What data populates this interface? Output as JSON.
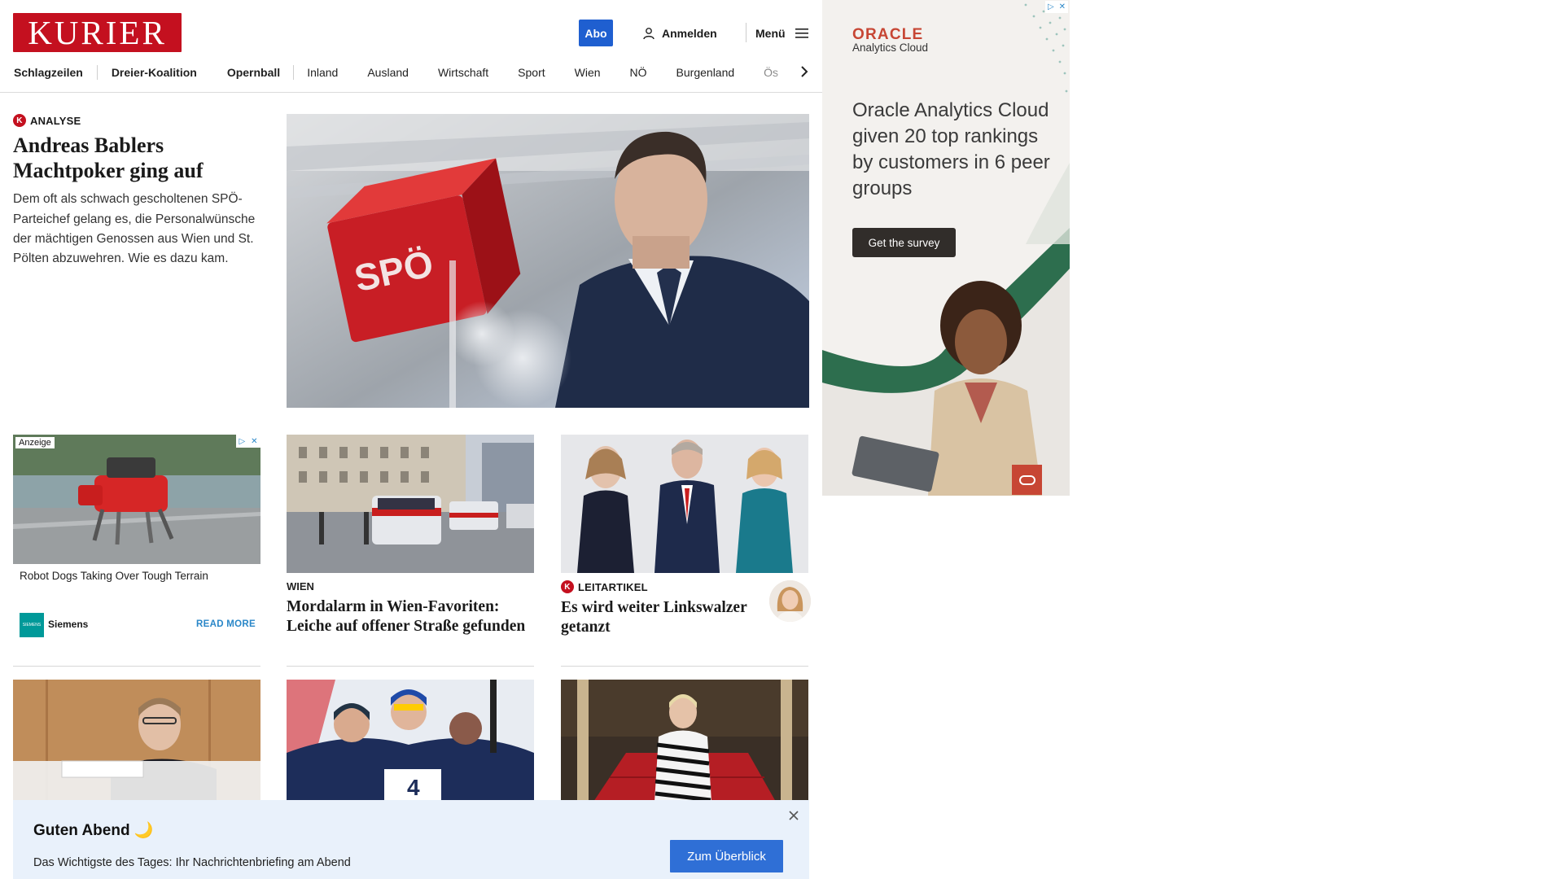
{
  "header": {
    "logo": "KURIER",
    "abo_label": "Abo",
    "login_label": "Anmelden",
    "menu_label": "Menü"
  },
  "nav": {
    "items": [
      "Schlagzeilen",
      "Dreier-Koalition",
      "Opernball",
      "Inland",
      "Ausland",
      "Wirtschaft",
      "Sport",
      "Wien",
      "NÖ",
      "Burgenland",
      "Ös"
    ]
  },
  "lead": {
    "kicker": "ANALYSE",
    "title": "Andreas Bablers Machtpoker ging auf",
    "teaser": "Dem oft als schwach gescholtenen SPÖ-Parteichef gelang es, die Personalwünsche der mächtigen Genossen aus Wien und St. Pölten abzuwehren. Wie es dazu kam.",
    "image_text": "SPÖ"
  },
  "native_ad": {
    "label": "Anzeige",
    "title": "Robot Dogs Taking Over Tough Terrain",
    "advertiser": "Siemens",
    "logo_text": "SIEMENS",
    "cta": "READ MORE"
  },
  "cards": [
    {
      "kicker": "WIEN",
      "title": "Mordalarm in Wien-Favoriten: Leiche auf offener Straße gefunden"
    },
    {
      "kicker": "LEITARTIKEL",
      "title": "Es wird weiter Linkswalzer getanzt"
    }
  ],
  "oracle_ad": {
    "logo": "ORACLE",
    "sub": "Analytics Cloud",
    "headline": "Oracle Analytics Cloud given 20 top rankings by customers in 6 peer groups",
    "cta": "Get the survey"
  },
  "briefing": {
    "title": "Guten Abend 🌙",
    "text": "Das Wichtigste des Tages: Ihr Nachrichtenbriefing am Abend",
    "button": "Zum Überblick"
  },
  "colors": {
    "brand_red": "#c4101f",
    "abo_blue": "#1f5fd0",
    "oracle_red": "#c74634",
    "briefing_bg": "#e9f1fb"
  }
}
